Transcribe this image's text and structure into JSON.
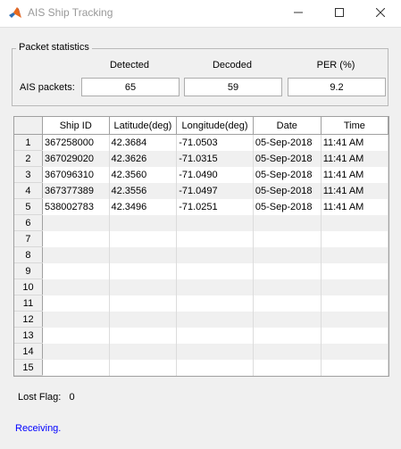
{
  "window": {
    "title": "AIS Ship Tracking"
  },
  "packet_stats": {
    "panel_title": "Packet statistics",
    "headers": [
      "Detected",
      "Decoded",
      "PER (%)"
    ],
    "row_label": "AIS packets:",
    "values": [
      "65",
      "59",
      "9.2"
    ]
  },
  "table": {
    "columns": [
      "Ship ID",
      "Latitude(deg)",
      "Longitude(deg)",
      "Date",
      "Time"
    ],
    "row_numbers": [
      "1",
      "2",
      "3",
      "4",
      "5",
      "6",
      "7",
      "8",
      "9",
      "10",
      "11",
      "12",
      "13",
      "14",
      "15"
    ],
    "rows": [
      [
        "367258000",
        "42.3684",
        "-71.0503",
        "05-Sep-2018",
        "11:41 AM"
      ],
      [
        "367029020",
        "42.3626",
        "-71.0315",
        "05-Sep-2018",
        "11:41 AM"
      ],
      [
        "367096310",
        "42.3560",
        "-71.0490",
        "05-Sep-2018",
        "11:41 AM"
      ],
      [
        "367377389",
        "42.3556",
        "-71.0497",
        "05-Sep-2018",
        "11:41 AM"
      ],
      [
        "538002783",
        "42.3496",
        "-71.0251",
        "05-Sep-2018",
        "11:41 AM"
      ],
      [
        "",
        "",
        "",
        "",
        ""
      ],
      [
        "",
        "",
        "",
        "",
        ""
      ],
      [
        "",
        "",
        "",
        "",
        ""
      ],
      [
        "",
        "",
        "",
        "",
        ""
      ],
      [
        "",
        "",
        "",
        "",
        ""
      ],
      [
        "",
        "",
        "",
        "",
        ""
      ],
      [
        "",
        "",
        "",
        "",
        ""
      ],
      [
        "",
        "",
        "",
        "",
        ""
      ],
      [
        "",
        "",
        "",
        "",
        ""
      ],
      [
        "",
        "",
        "",
        "",
        ""
      ]
    ]
  },
  "lost_flag": {
    "label": "Lost Flag:",
    "value": "0"
  },
  "status": {
    "text": "Receiving.",
    "color": "#0000ff"
  },
  "icons": {
    "app": "matlab-logo-icon",
    "minimize": "minimize-icon",
    "maximize": "maximize-icon",
    "close": "close-icon"
  }
}
